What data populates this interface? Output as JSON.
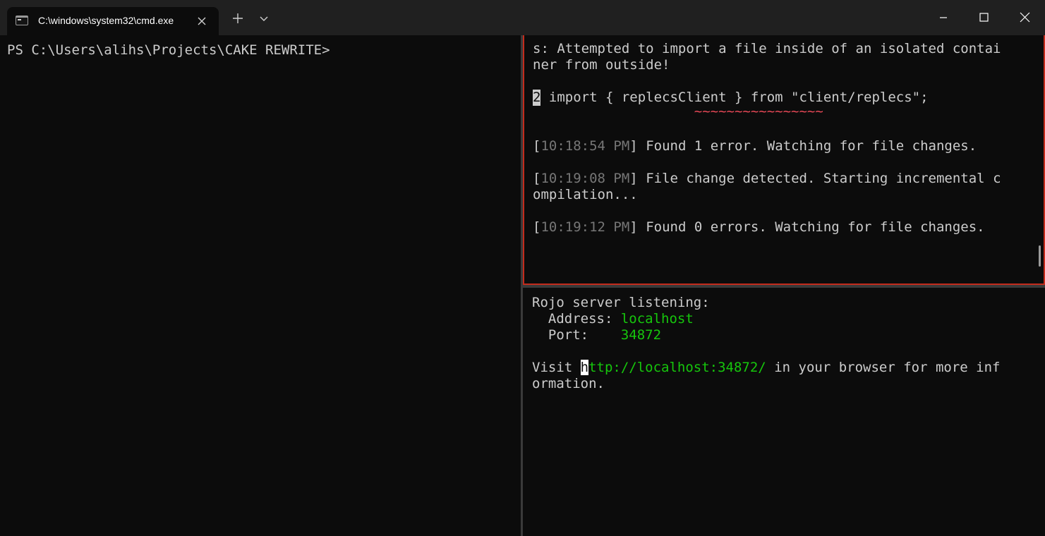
{
  "tab": {
    "title": "C:\\windows\\system32\\cmd.exe",
    "icon": "terminal-icon"
  },
  "toolbar": {
    "new_tab": "+",
    "dropdown": "⌄"
  },
  "left_pane": {
    "prompt": "PS C:\\Users\\alihs\\Projects\\CAKE REWRITE>"
  },
  "top_right_pane": {
    "msg1": "s: Attempted to import a file inside of an isolated contai",
    "msg2": "ner from outside!",
    "code_line_num": "2",
    "code_line_text": " import { replecsClient } from \"client/replecs\";",
    "squiggle": "~~~~~~~~~~~~~~~~",
    "log1_time": "10:18:54 PM",
    "log1_text": " Found 1 error. Watching for file changes.",
    "log2_time": "10:19:08 PM",
    "log2_text": " File change detected. Starting incremental c",
    "log2_cont": "ompilation...",
    "log3_time": "10:19:12 PM",
    "log3_text": " Found 0 errors. Watching for file changes."
  },
  "bottom_right_pane": {
    "heading": "Rojo server listening:",
    "address_label": "  Address: ",
    "address_value": "localhost",
    "port_label": "  Port:    ",
    "port_value": "34872",
    "visit_prefix": "Visit ",
    "url_first": "h",
    "url_rest": "ttp://localhost:34872/",
    "visit_suffix": " in your browser for more inf",
    "visit_cont": "ormation."
  },
  "colors": {
    "accent_border": "#c42b1c",
    "green": "#16c60c",
    "squiggle": "#e74856"
  }
}
